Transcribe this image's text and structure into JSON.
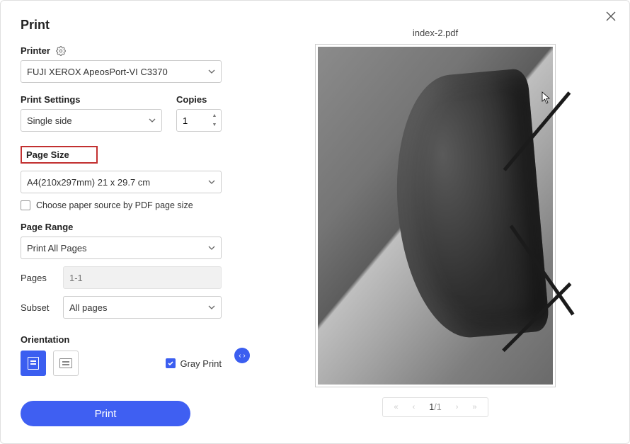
{
  "title": "Print",
  "printer": {
    "label": "Printer",
    "selected": "FUJI XEROX ApeosPort-VI C3370"
  },
  "print_settings": {
    "label": "Print Settings",
    "selected": "Single side"
  },
  "copies": {
    "label": "Copies",
    "value": "1"
  },
  "page_size": {
    "label": "Page Size",
    "selected": "A4(210x297mm) 21 x 29.7 cm"
  },
  "paper_source": {
    "label": "Choose paper source by PDF page size",
    "checked": false
  },
  "page_range": {
    "label": "Page Range",
    "selected": "Print All Pages"
  },
  "pages": {
    "label": "Pages",
    "placeholder": "1-1"
  },
  "subset": {
    "label": "Subset",
    "selected": "All pages"
  },
  "orientation": {
    "label": "Orientation",
    "selected": "portrait"
  },
  "gray_print": {
    "label": "Gray Print",
    "checked": true
  },
  "print_button": "Print",
  "preview": {
    "filename": "index-2.pdf",
    "page": "1",
    "total": "/1"
  }
}
